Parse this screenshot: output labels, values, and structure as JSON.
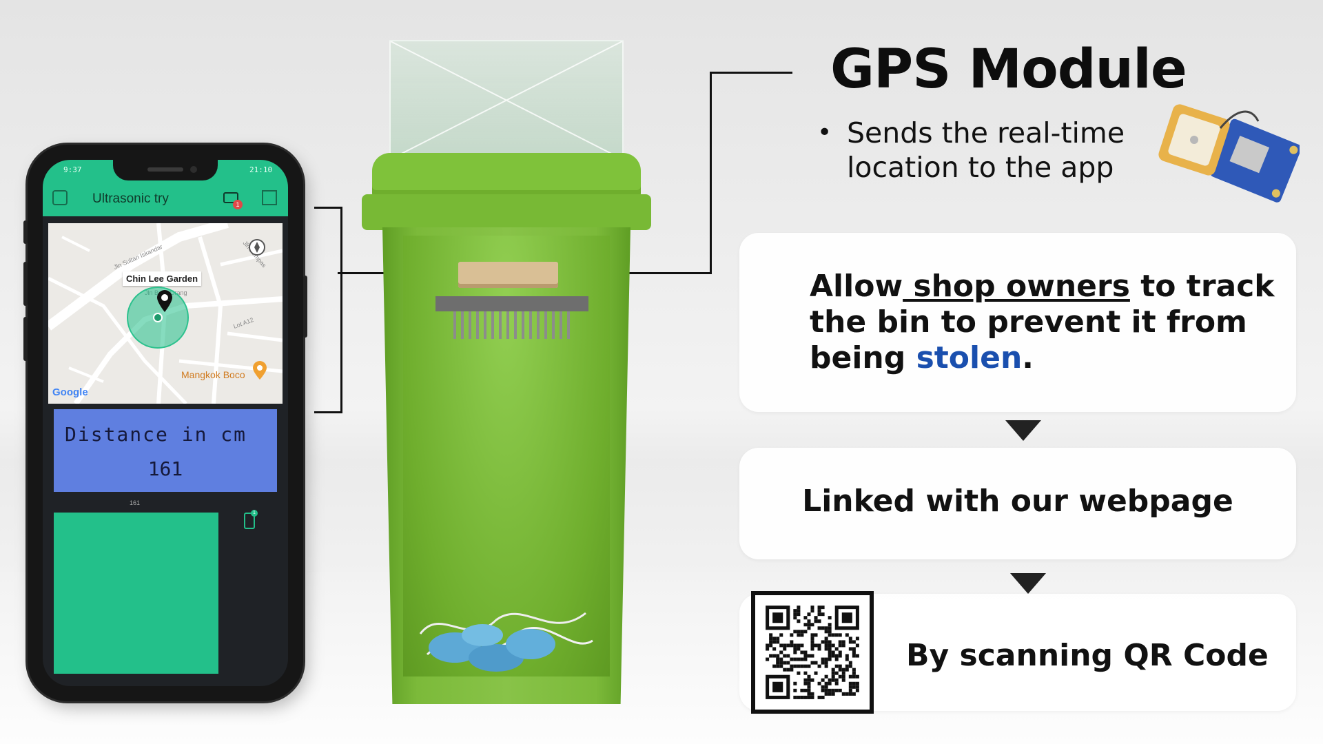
{
  "phone": {
    "status_left": "9:37",
    "status_right": "21:10",
    "app_title": "Ultrasonic try",
    "notification_count": "1",
    "device_count": "1",
    "map": {
      "place_label": "Chin Lee Garden",
      "road_1": "Jln Sultan Iskandar",
      "road_2": "Jln Bukit Orang",
      "road_3": "Lot A12",
      "road_4": "Jln Kempas",
      "poi": "Mangkok Boco",
      "logo": "Google"
    },
    "distance_label": "Distance in cm",
    "distance_value": "161",
    "level_small_value": "161",
    "level_percent": 100
  },
  "gps": {
    "title": "GPS Module",
    "bullet": "•",
    "description": "Sends the real-time location to the app"
  },
  "cards": {
    "card1": {
      "part1": "Allow",
      "link": " shop owners",
      "part2": " to track the bin to prevent it from being ",
      "highlight": "stolen",
      "end": "."
    },
    "card2": "Linked with our webpage",
    "card3": "By scanning QR Code"
  },
  "colors": {
    "app_green": "#23c08a",
    "distance_blue": "#5f7fe0",
    "highlight_blue": "#1a4fae",
    "bin_green": "#7fc23a"
  },
  "icons": [
    "back-icon",
    "device-icon",
    "square-icon",
    "compass-icon",
    "location-pin-icon",
    "poi-icon",
    "device-small-icon",
    "down-arrow-icon",
    "gps-chip-icon",
    "qr-code-icon"
  ]
}
